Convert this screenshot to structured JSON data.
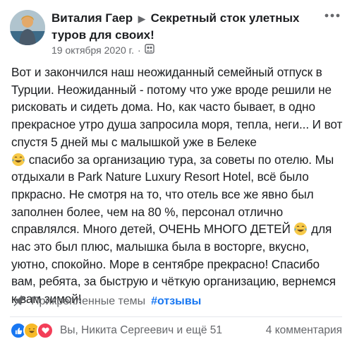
{
  "post": {
    "author": "Виталия Гаер",
    "group": "Секретный сток улетных туров для своих!",
    "date": "19 октября 2020 г.",
    "date_separator": "·",
    "audience_icon": "group-icon",
    "more_icon": "more-icon",
    "text": {
      "p1": "Вот и закончился наш неожиданный семейный отпуск в Турции. Неожиданный - потому что уже вроде решили не рисковать и сидеть дома. Но, как часто бывает, в одно прекрасное утро душа запросила моря, тепла, неги... И вот спустя 5 дней мы с малышкой уже в Белеке",
      "p2": "спасибо за организацию тура, за советы по отелю. Мы отдыхали в Park Nature Luxury Resort Hotel, всё было пркрасно. Не смотря на то, что отель все же явно был заполнен более, чем на 80 %, персонал отлично справлялся. Много детей, ОЧЕНЬ МНОГО ДЕТЕЙ",
      "p3": "для нас это был плюс, малышка была в восторге, вкусно, уютно, спокойно. Море в сентябре прекрасно! Спасибо вам, ребята, за быструю и чёткую организацию, вернемся к вам зимой!"
    },
    "emoji_icon": "laughing-tears-emoji",
    "pinned_label": "Прикрепленные темы",
    "pinned_tag": "#отзывы",
    "reactions_text": "Вы, Никита Сергеевич и ещё 51",
    "comments_text": "4 комментария",
    "colors": {
      "like": "#1877f2",
      "haha": "#f7b928",
      "love": "#f33e58",
      "link": "#1877f2",
      "secondary": "#65676b"
    }
  }
}
